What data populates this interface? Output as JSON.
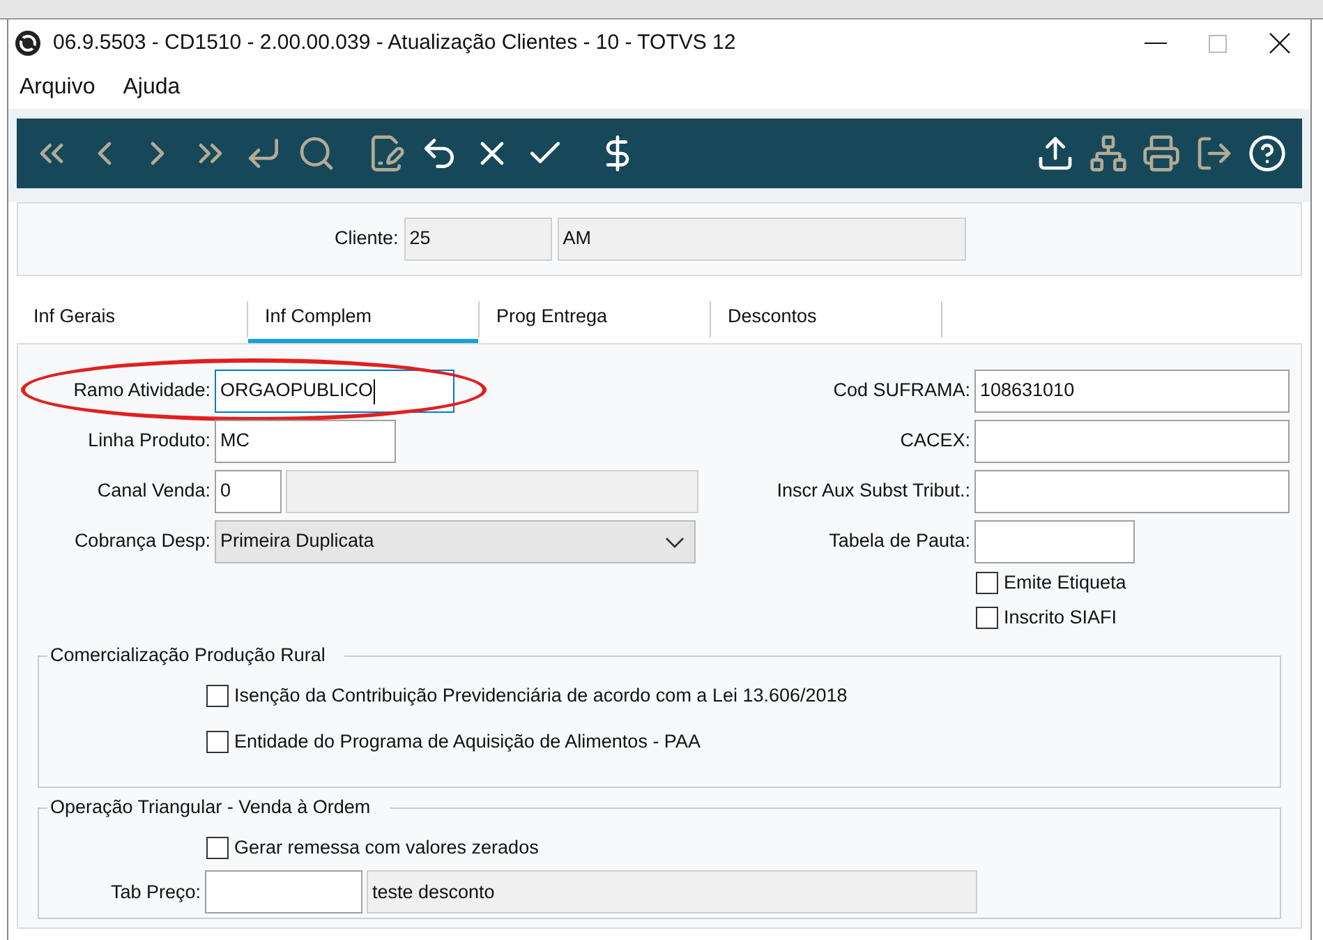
{
  "window": {
    "title": "06.9.5503 - CD1510 - 2.00.00.039 - Atualização Clientes - 10 - TOTVS 12"
  },
  "menu": [
    "Arquivo",
    "Ajuda"
  ],
  "toolbar": [
    {
      "disabled": true
    },
    {
      "disabled": true
    },
    {
      "disabled": true
    },
    {
      "disabled": true
    },
    {
      "disabled": true
    },
    {
      "disabled": true
    },
    {
      "disabled": true
    },
    {
      "disabled": false
    },
    {
      "disabled": false
    },
    {
      "disabled": false
    },
    {
      "disabled": false
    },
    {
      "disabled": false
    },
    {
      "disabled": true
    },
    {
      "disabled": true
    },
    {
      "disabled": true
    },
    {
      "disabled": false
    }
  ],
  "header": {
    "label": "Cliente:",
    "code": "25",
    "name": "AM"
  },
  "tabs": [
    {
      "label": "Inf Gerais",
      "selected": false
    },
    {
      "label": "Inf Complem",
      "selected": true
    },
    {
      "label": "Prog Entrega",
      "selected": false
    },
    {
      "label": "Descontos",
      "selected": false
    }
  ],
  "left_fields": [
    {
      "kind": "text",
      "label": "Ramo Atividade:",
      "value": "ORGAOPUBLICO",
      "focused": true,
      "highlighted": true
    },
    {
      "kind": "text",
      "label": "Linha Produto:",
      "value": "MC",
      "focused": false,
      "highlighted": false
    },
    {
      "kind": "code",
      "label": "Canal Venda:",
      "value": "0",
      "focused": false,
      "highlighted": false
    },
    {
      "kind": "select",
      "label": "Cobrança Desp:",
      "value": "Primeira Duplicata",
      "focused": false,
      "highlighted": false
    }
  ],
  "right_fields": [
    {
      "kind": "text",
      "label": "Cod SUFRAMA:",
      "value": "108631010"
    },
    {
      "kind": "text",
      "label": "CACEX:"
    },
    {
      "kind": "text",
      "label": "Inscr Aux Subst Tribut.:"
    },
    {
      "kind": "short",
      "label": "Tabela de Pauta:"
    },
    {
      "kind": "checkbox",
      "label": "Emite Etiqueta",
      "checked": false
    },
    {
      "kind": "checkbox",
      "label": "Inscrito SIAFI",
      "checked": false
    }
  ],
  "rural_group": {
    "title": "Comercialização Produção Rural",
    "options": [
      {
        "label": "Isenção da Contribuição Previdenciária de acordo com a Lei 13.606/2018",
        "checked": false
      },
      {
        "label": "Entidade do Programa de Aquisição de Alimentos - PAA",
        "checked": false
      }
    ]
  },
  "triangular_group": {
    "title": "Operação Triangular - Venda à Ordem",
    "option": {
      "label": "Gerar remessa com valores zerados",
      "checked": false
    },
    "price_table": {
      "label": "Tab Preço:",
      "description": "teste desconto"
    }
  }
}
